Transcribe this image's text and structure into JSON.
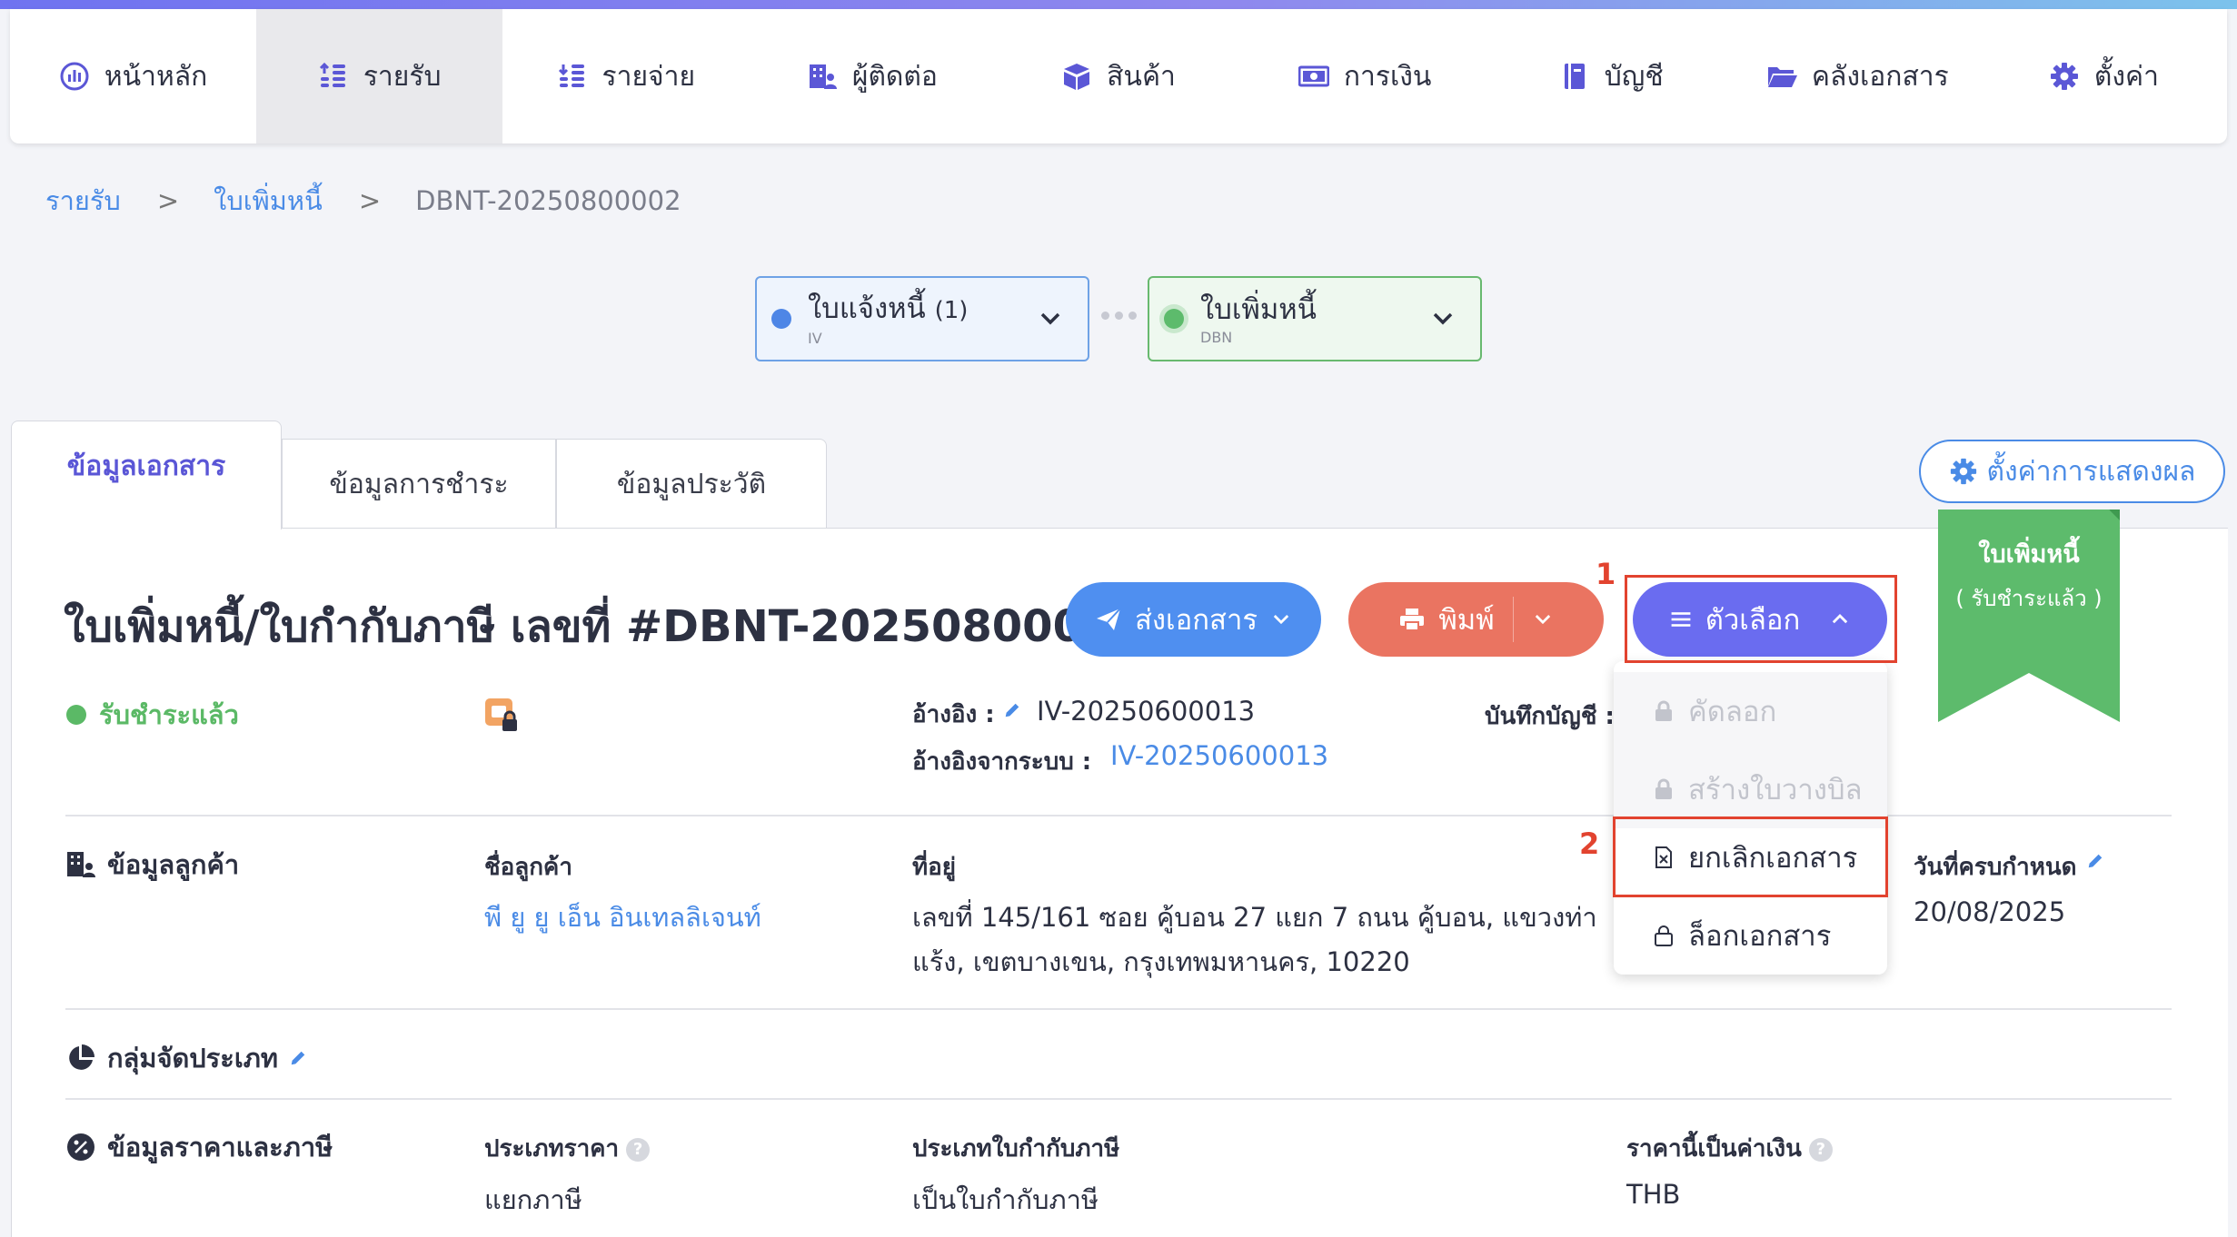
{
  "nav": {
    "items": [
      {
        "label": "หน้าหลัก",
        "icon": "dashboard-icon"
      },
      {
        "label": "รายรับ",
        "icon": "income-icon"
      },
      {
        "label": "รายจ่าย",
        "icon": "expense-icon"
      },
      {
        "label": "ผู้ติดต่อ",
        "icon": "contacts-icon"
      },
      {
        "label": "สินค้า",
        "icon": "box-icon"
      },
      {
        "label": "การเงิน",
        "icon": "money-icon"
      },
      {
        "label": "บัญชี",
        "icon": "ledger-icon"
      },
      {
        "label": "คลังเอกสาร",
        "icon": "folder-icon"
      },
      {
        "label": "ตั้งค่า",
        "icon": "gear-icon"
      }
    ],
    "active": "รายรับ"
  },
  "breadcrumb": {
    "items": [
      "รายรับ",
      "ใบเพิ่มหนี้"
    ],
    "separator": ">",
    "current": "DBNT-20250800002"
  },
  "flow": {
    "invoice": {
      "title": "ใบแจ้งหนี้",
      "count": "(1)",
      "code": "IV",
      "color": "#4e86e6"
    },
    "debit_note": {
      "title": "ใบเพิ่มหนี้",
      "code": "DBN",
      "color": "#5dbb6c"
    }
  },
  "tabs": {
    "document_info": "ข้อมูลเอกสาร",
    "payment_info": "ข้อมูลการชำระ",
    "history_info": "ข้อมูลประวัติ"
  },
  "display_settings_label": "ตั้งค่าการแสดงผล",
  "ribbon": {
    "title": "ใบเพิ่มหนี้",
    "subtitle": "( รับชำระแล้ว )",
    "color": "#5dbb6c"
  },
  "document": {
    "title": "ใบเพิ่มหนี้/ใบกำกับภาษี เลขที่ #DBNT-20250800002",
    "status": "รับชำระแล้ว",
    "reference_label": "อ้างอิง :",
    "reference_value": "IV-20250600013",
    "system_reference_label": "อ้างอิงจากระบบ :",
    "system_reference_value": "IV-20250600013",
    "accounting_label": "บันทึกบัญชี :"
  },
  "actions": {
    "send_label": "ส่งเอกสาร",
    "print_label": "พิมพ์",
    "options_label": "ตัวเลือก"
  },
  "options_menu": {
    "items": [
      {
        "label": "คัดลอก",
        "disabled": true,
        "icon": "lock-icon"
      },
      {
        "label": "สร้างใบวางบิล",
        "disabled": true,
        "icon": "lock-icon"
      },
      {
        "label": "ยกเลิกเอกสาร",
        "disabled": false,
        "icon": "cancel-document-icon"
      },
      {
        "label": "ล็อกเอกสาร",
        "disabled": false,
        "icon": "lock-outline-icon"
      }
    ]
  },
  "annotations": {
    "first": "1",
    "second": "2",
    "color": "#e2432f"
  },
  "customer": {
    "section_title": "ข้อมูลลูกค้า",
    "name_label": "ชื่อลูกค้า",
    "name_value": "พี ยู ยู เอ็น อินเทลลิเจนท์",
    "address_label": "ที่อยู่",
    "address_line1": "เลขที่ 145/161 ซอย คู้บอน 27 แยก 7 ถนน คู้บอน, แขวงท่า",
    "address_line2": "แร้ง, เขตบางเขน, กรุงเทพมหานคร, 10220",
    "due_date_label": "วันที่ครบกำหนด",
    "due_date_value": "20/08/2025"
  },
  "classification": {
    "section_title": "กลุ่มจัดประเภท"
  },
  "pricing": {
    "section_title": "ข้อมูลราคาและภาษี",
    "price_type_label": "ประเภทราคา",
    "price_type_value": "แยกภาษี",
    "tax_invoice_type_label": "ประเภทใบกำกับภาษี",
    "tax_invoice_type_value": "เป็นใบกำกับภาษี",
    "currency_label": "ราคานี้เป็นค่าเงิน",
    "currency_value": "THB",
    "help_glyph": "?"
  }
}
